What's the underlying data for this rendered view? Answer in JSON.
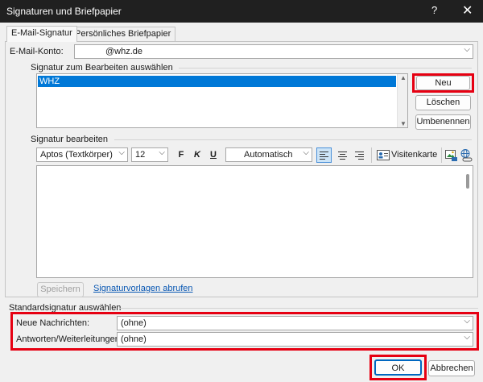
{
  "window": {
    "title": "Signaturen und Briefpapier",
    "help_label": "?",
    "close_label": "✕"
  },
  "tabs": [
    {
      "label": "E-Mail-Signatur"
    },
    {
      "label": "Persönliches Briefpapier"
    }
  ],
  "account": {
    "label": "E-Mail-Konto:",
    "value": "@whz.de"
  },
  "select_signature": {
    "heading": "Signatur zum Bearbeiten auswählen",
    "items": [
      "WHZ"
    ],
    "buttons": {
      "new": "Neu",
      "delete": "Löschen",
      "rename": "Umbenennen"
    }
  },
  "edit_signature": {
    "heading": "Signatur bearbeiten",
    "font": "Aptos (Textkörper)",
    "size": "12",
    "bold": "F",
    "italic": "K",
    "underline": "U",
    "color": "Automatisch",
    "business_card": "Visitenkarte",
    "save": "Speichern",
    "templates_link": "Signaturvorlagen abrufen"
  },
  "default_signature": {
    "heading": "Standardsignatur auswählen",
    "new_messages_label": "Neue Nachrichten:",
    "new_messages_value": "(ohne)",
    "replies_label": "Antworten/Weiterleitungen:",
    "replies_value": "(ohne)"
  },
  "footer": {
    "ok": "OK",
    "cancel": "Abbrechen"
  },
  "colors": {
    "highlight": "#e60012",
    "selection": "#0078d7",
    "titlebar": "#202020"
  }
}
